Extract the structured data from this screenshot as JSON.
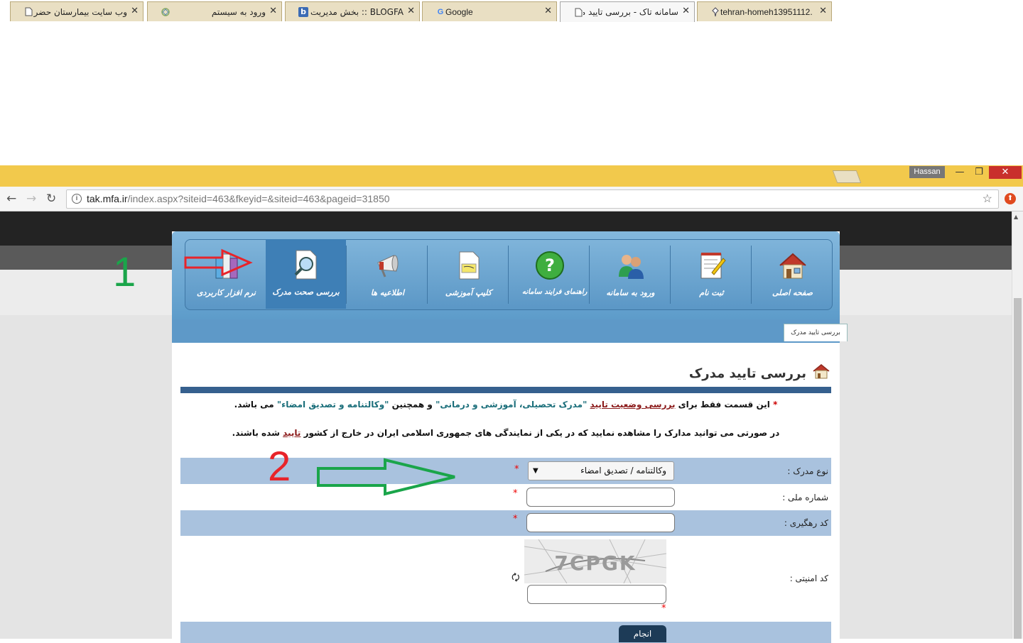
{
  "browser": {
    "tabs": [
      {
        "title": "وب سایت بیمارستان حضرت سی",
        "active": false,
        "favicon": "page-icon"
      },
      {
        "title": "ورود به سیستم",
        "active": false,
        "favicon": "site-icon"
      },
      {
        "title": "BLOGFA :: بخش مدیریت not",
        "active": false,
        "favicon": "blogfa-icon"
      },
      {
        "title": "Google",
        "active": false,
        "favicon": "google-icon"
      },
      {
        "title": "سامانه تاک - بررسی تایید مدرک",
        "active": true,
        "favicon": "page-icon"
      },
      {
        "title": "tehran-homeh13951112.",
        "active": false,
        "favicon": "pin-icon"
      }
    ],
    "profile_name": "Hassan",
    "url_host": "tak.mfa.ir",
    "url_path": "/index.aspx?siteid=463&fkeyid=&siteid=463&pageid=31850"
  },
  "site": {
    "menu": [
      {
        "label": "صفحه اصلی",
        "icon": "home-icon"
      },
      {
        "label": "ثبت نام",
        "icon": "register-notepad-icon"
      },
      {
        "label": "ورود به سامانه",
        "icon": "users-login-icon"
      },
      {
        "label": "راهنمای فرآیند سامانه",
        "icon": "help-question-icon"
      },
      {
        "label": "کلیپ آموزشی",
        "icon": "clip-document-icon"
      },
      {
        "label": "اطلاعیه ها",
        "icon": "megaphone-icon"
      },
      {
        "label": "بررسی صحت مدرک",
        "icon": "document-search-icon",
        "active": true
      },
      {
        "label": "نرم افزار کاربردی",
        "icon": "software-books-icon"
      }
    ],
    "breadcrumb": "بررسی تایید مدرک",
    "page_title": "بررسی تایید مدرک",
    "notice1": {
      "star": "*",
      "part1": "این قسمت فقط برای",
      "link1": "بررسی وضعیت تایید",
      "quote1": "\"مدرک تحصیلی، آموزشی و درمانی\"",
      "part2": "و همچنین",
      "quote2": "\"وکالتنامه و تصدیق امضاء\"",
      "part3": "می باشد."
    },
    "notice2": {
      "part1": "در صورتی می توانید مدارک را مشاهده نمایید که در یکی از نمایندگی های جمهوری اسلامی ایران در خارج از کشور",
      "link": "تایید",
      "part2": "شده باشند."
    },
    "form": {
      "doc_type_label": "نوع مدرک :",
      "doc_type_value": "وکالتنامه / تصدیق امضاء",
      "national_id_label": "شماره ملی :",
      "tracking_code_label": "کد رهگیری :",
      "captcha_label": "کد امنیتی :",
      "captcha_text": "7CPGK",
      "required_mark": "*",
      "submit_label": "انجام"
    }
  },
  "annotations": {
    "marker1": "1",
    "marker2": "2",
    "marker1_color": "#1aa54a",
    "marker2_color": "#e8242a"
  }
}
